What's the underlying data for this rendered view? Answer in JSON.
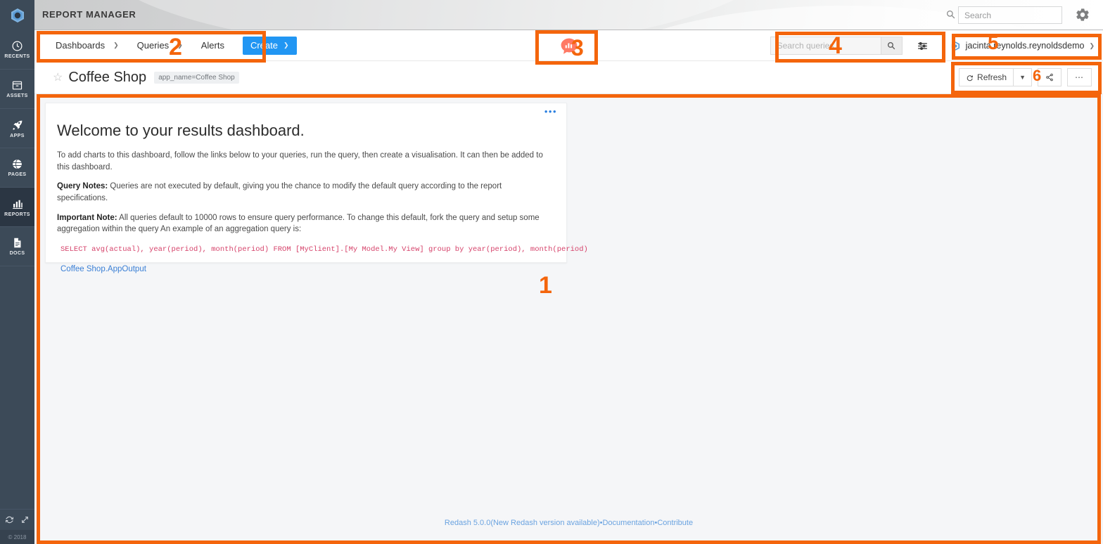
{
  "app": {
    "title": "REPORT MANAGER",
    "logo_icon": "hexagon-nut-logo",
    "search_placeholder": "Search",
    "search_value": "",
    "search_icon": "search-icon",
    "settings_icon": "gear-icon",
    "copyright": "© 2018"
  },
  "sidebar": {
    "items": [
      {
        "label": "RECENTS",
        "icon": "clock-icon",
        "active": false
      },
      {
        "label": "ASSETS",
        "icon": "archive-box-icon",
        "active": false
      },
      {
        "label": "APPS",
        "icon": "rocket-icon",
        "active": false
      },
      {
        "label": "PAGES",
        "icon": "globe-icon",
        "active": false
      },
      {
        "label": "REPORTS",
        "icon": "bar-chart-icon",
        "active": true
      },
      {
        "label": "DOCS",
        "icon": "document-icon",
        "active": false
      }
    ],
    "tools": [
      {
        "icon": "refresh-icon"
      },
      {
        "icon": "expand-icon"
      }
    ]
  },
  "navbar": {
    "dashboards_label": "Dashboards",
    "queries_label": "Queries",
    "alerts_label": "Alerts",
    "create_label": "Create",
    "caret_icon": "chevron-down-icon",
    "redash_logo_icon": "redash-logo-icon",
    "query_search_placeholder": "Search queries...",
    "query_search_value": "",
    "query_search_icon": "search-icon",
    "filter_icon": "sliders-icon",
    "user_name": "jacinta.reynolds.reynoldsdemo",
    "user_avatar_icon": "hexagon-avatar-icon"
  },
  "dashboard": {
    "star_icon": "star-outline-icon",
    "title": "Coffee Shop",
    "tag": "app_name=Coffee Shop",
    "refresh_label": "Refresh",
    "refresh_icon": "refresh-icon",
    "refresh_caret_icon": "caret-down-icon",
    "share_icon": "share-icon",
    "more_icon": "ellipsis-icon"
  },
  "widget": {
    "menu_icon": "ellipsis-icon",
    "menu_glyph": "•••",
    "title": "Welcome to your results dashboard.",
    "intro": "To add charts to this dashboard, follow the links below to your queries, run the query, then create a visualisation. It can then be added to this dashboard.",
    "query_notes_label": "Query Notes:",
    "query_notes_text": " Queries are not executed by default, giving you the chance to modify the default query according to the report specifications.",
    "important_label": "Important Note:",
    "important_text": " All queries default to 10000 rows to ensure query performance. To change this default, fork the query and setup some aggregation within the query An example of an aggregation query is:",
    "code": "SELECT avg(actual), year(period), month(period) FROM [MyClient].[My Model.My View] group by year(period), month(period)",
    "link_label": "Coffee Shop.AppOutput"
  },
  "footer": {
    "version": "Redash 5.0.0(New Redash version available)",
    "sep": "•",
    "documentation": "Documentation",
    "contribute": "Contribute"
  },
  "annotations": {
    "accent_color": "#f4650c",
    "markers": [
      {
        "number": "1",
        "target": "dashboard-content-area"
      },
      {
        "number": "2",
        "target": "redash-navigation-bar"
      },
      {
        "number": "3",
        "target": "redash-logo"
      },
      {
        "number": "4",
        "target": "query-search-box"
      },
      {
        "number": "5",
        "target": "user-menu"
      },
      {
        "number": "6",
        "target": "dashboard-actions"
      }
    ]
  }
}
